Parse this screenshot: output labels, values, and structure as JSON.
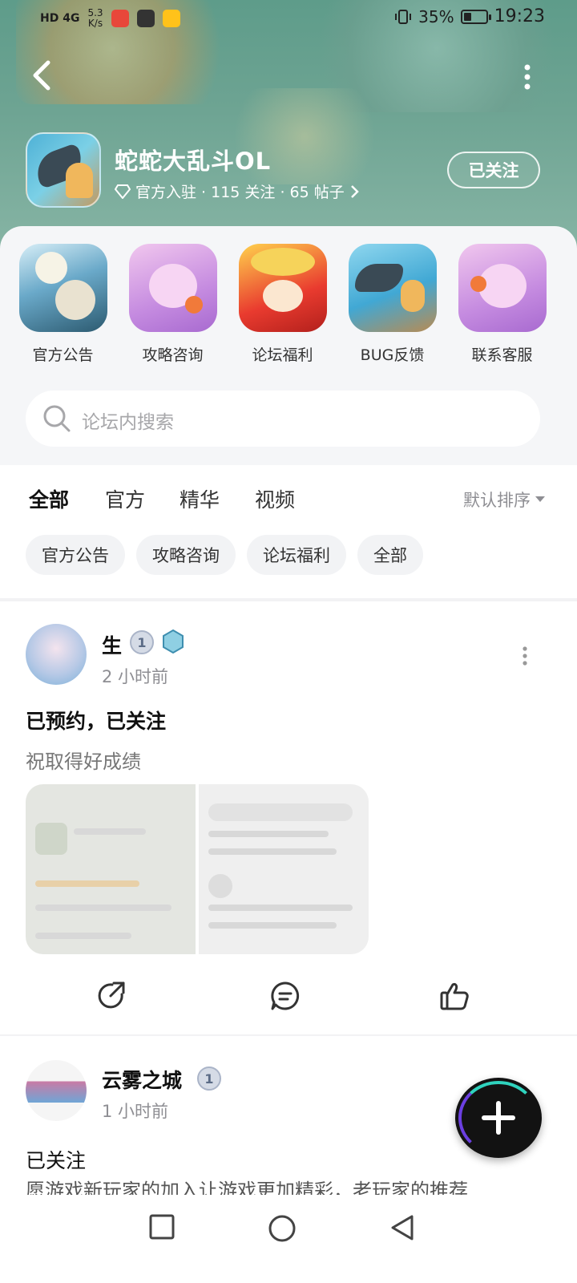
{
  "status_bar": {
    "network": "HD 4G",
    "speed_top": "5.3",
    "speed_bottom": "K/s",
    "battery_text": "35%",
    "time": "19:23",
    "battery_level": 0.35
  },
  "forum": {
    "title": "蛇蛇大乱斗OL",
    "meta": "官方入驻 · 115 关注 · 65 帖子",
    "follow_label": "已关注"
  },
  "quick_links": [
    {
      "label": "官方公告",
      "icon": "official-announcement-icon"
    },
    {
      "label": "攻略咨询",
      "icon": "strategy-icon"
    },
    {
      "label": "论坛福利",
      "icon": "welfare-icon"
    },
    {
      "label": "BUG反馈",
      "icon": "bug-feedback-icon"
    },
    {
      "label": "联系客服",
      "icon": "customer-service-icon"
    }
  ],
  "search": {
    "placeholder": "论坛内搜索"
  },
  "tabs": [
    {
      "label": "全部",
      "active": true
    },
    {
      "label": "官方"
    },
    {
      "label": "精华"
    },
    {
      "label": "视频"
    }
  ],
  "sort": {
    "label": "默认排序"
  },
  "chips": [
    "官方公告",
    "攻略咨询",
    "论坛福利",
    "全部"
  ],
  "posts": [
    {
      "username": "生",
      "level": "1",
      "time": "2 小时前",
      "title": "已预约，已关注",
      "body": "祝取得好成绩"
    },
    {
      "username": "云雾之城",
      "level": "1",
      "time": "1 小时前",
      "title": "已关注",
      "body": "愿游戏新玩家的加入让游戏更加精彩，老玩家的推荐"
    }
  ],
  "colors": {
    "accent": "#2fd3be",
    "banner": "#6ea493",
    "fab": "#121212"
  }
}
